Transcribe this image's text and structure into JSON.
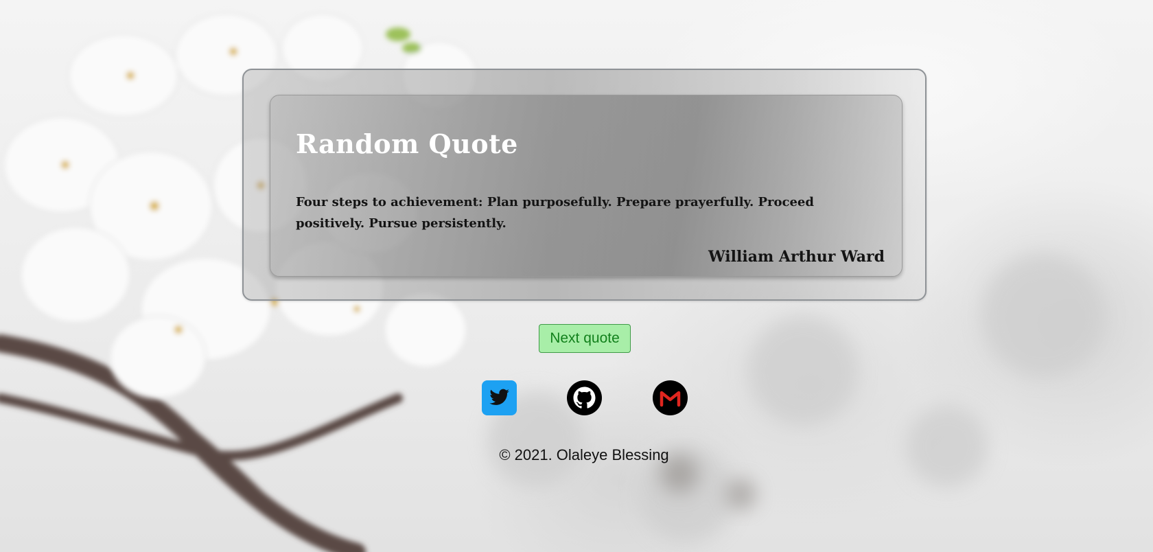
{
  "quote": {
    "title": "Random Quote",
    "text": "Four steps to achievement: Plan purposefully. Prepare prayerfully. Proceed positively. Pursue persistently.",
    "author": "William Arthur Ward"
  },
  "actions": {
    "next_label": "Next quote"
  },
  "socials": [
    {
      "name": "Twitter",
      "icon": "twitter-icon",
      "color": "#1da1f2"
    },
    {
      "name": "GitHub",
      "icon": "github-icon",
      "color": "#000000"
    },
    {
      "name": "Gmail",
      "icon": "gmail-icon",
      "color": "#000000"
    }
  ],
  "footer": {
    "text": "© 2021. Olaleye Blessing"
  },
  "colors": {
    "button_bg": "#a8eea8",
    "button_text": "#12801c",
    "title_text": "#ffffff",
    "twitter_blue": "#1da1f2",
    "gmail_red": "#e0261f"
  }
}
